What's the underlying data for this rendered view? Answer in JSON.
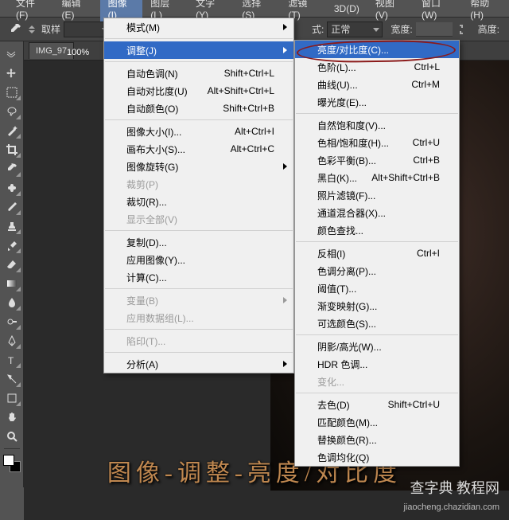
{
  "menubar": {
    "items": [
      {
        "label": "文件(F)"
      },
      {
        "label": "编辑(E)"
      },
      {
        "label": "图像(I)"
      },
      {
        "label": "图层(L)"
      },
      {
        "label": "文字(Y)"
      },
      {
        "label": "选择(S)"
      },
      {
        "label": "滤镜(T)"
      },
      {
        "label": "3D(D)"
      },
      {
        "label": "视图(V)"
      },
      {
        "label": "窗口(W)"
      },
      {
        "label": "帮助(H)"
      }
    ],
    "active_index": 2
  },
  "optionbar": {
    "sample_label": "取样",
    "mode_prefix": "式:",
    "mode_value": "正常",
    "width_label": "宽度:",
    "height_label": "高度:"
  },
  "tab": {
    "title": "IMG_97"
  },
  "zoom": {
    "value": "100%"
  },
  "image_menu": {
    "mode": "模式(M)",
    "adjust": "调整(J)",
    "auto_tone": {
      "label": "自动色调(N)",
      "sc": "Shift+Ctrl+L"
    },
    "auto_contrast": {
      "label": "自动对比度(U)",
      "sc": "Alt+Shift+Ctrl+L"
    },
    "auto_color": {
      "label": "自动颜色(O)",
      "sc": "Shift+Ctrl+B"
    },
    "image_size": {
      "label": "图像大小(I)...",
      "sc": "Alt+Ctrl+I"
    },
    "canvas_size": {
      "label": "画布大小(S)...",
      "sc": "Alt+Ctrl+C"
    },
    "image_rotation": "图像旋转(G)",
    "crop": "裁剪(P)",
    "trim": "裁切(R)...",
    "reveal_all": "显示全部(V)",
    "duplicate": "复制(D)...",
    "apply_image": "应用图像(Y)...",
    "calculations": "计算(C)...",
    "variables": "变量(B)",
    "apply_data": "应用数据组(L)...",
    "trap": "陷印(T)...",
    "analysis": "分析(A)"
  },
  "adjust_menu": {
    "brightness": "亮度/对比度(C)...",
    "levels": {
      "label": "色阶(L)...",
      "sc": "Ctrl+L"
    },
    "curves": {
      "label": "曲线(U)...",
      "sc": "Ctrl+M"
    },
    "exposure": "曝光度(E)...",
    "vibrance": "自然饱和度(V)...",
    "hue": {
      "label": "色相/饱和度(H)...",
      "sc": "Ctrl+U"
    },
    "color_balance": {
      "label": "色彩平衡(B)...",
      "sc": "Ctrl+B"
    },
    "bw": {
      "label": "黑白(K)...",
      "sc": "Alt+Shift+Ctrl+B"
    },
    "photo_filter": "照片滤镜(F)...",
    "channel_mixer": "通道混合器(X)...",
    "color_lookup": "颜色查找...",
    "invert": {
      "label": "反相(I)",
      "sc": "Ctrl+I"
    },
    "posterize": "色调分离(P)...",
    "threshold": "阈值(T)...",
    "gradient_map": "渐变映射(G)...",
    "selective": "可选颜色(S)...",
    "shadows": "阴影/高光(W)...",
    "hdr": "HDR 色调...",
    "variations": "变化...",
    "desaturate": {
      "label": "去色(D)",
      "sc": "Shift+Ctrl+U"
    },
    "match": "匹配颜色(M)...",
    "replace": "替换颜色(R)...",
    "equalize": "色调均化(Q)"
  },
  "caption": "图像-调整-亮度/对比度",
  "watermark": {
    "line1": "查字典 教程网",
    "line2": "jiaocheng.chazidian.com"
  }
}
